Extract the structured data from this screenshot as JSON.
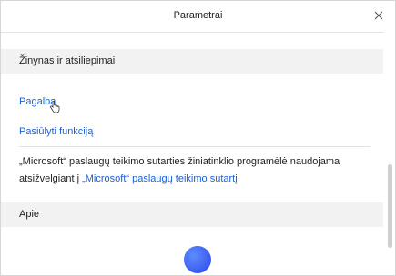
{
  "window": {
    "title": "Parametrai"
  },
  "sections": {
    "help": "Žinynas ir atsiliepimai",
    "about": "Apie"
  },
  "links": {
    "help": "Pagalba",
    "suggest": "Pasiūlyti funkciją"
  },
  "description": {
    "text": "„Microsoft“ paslaugų teikimo sutarties žiniatinklio programėlė naudojama atsižvelgiant į ",
    "link": "„Microsoft“ paslaugų teikimo sutartį"
  },
  "icons": {
    "close": "close-icon",
    "cursor": "hand-pointer-icon",
    "logo": "blue-circle-logo"
  }
}
